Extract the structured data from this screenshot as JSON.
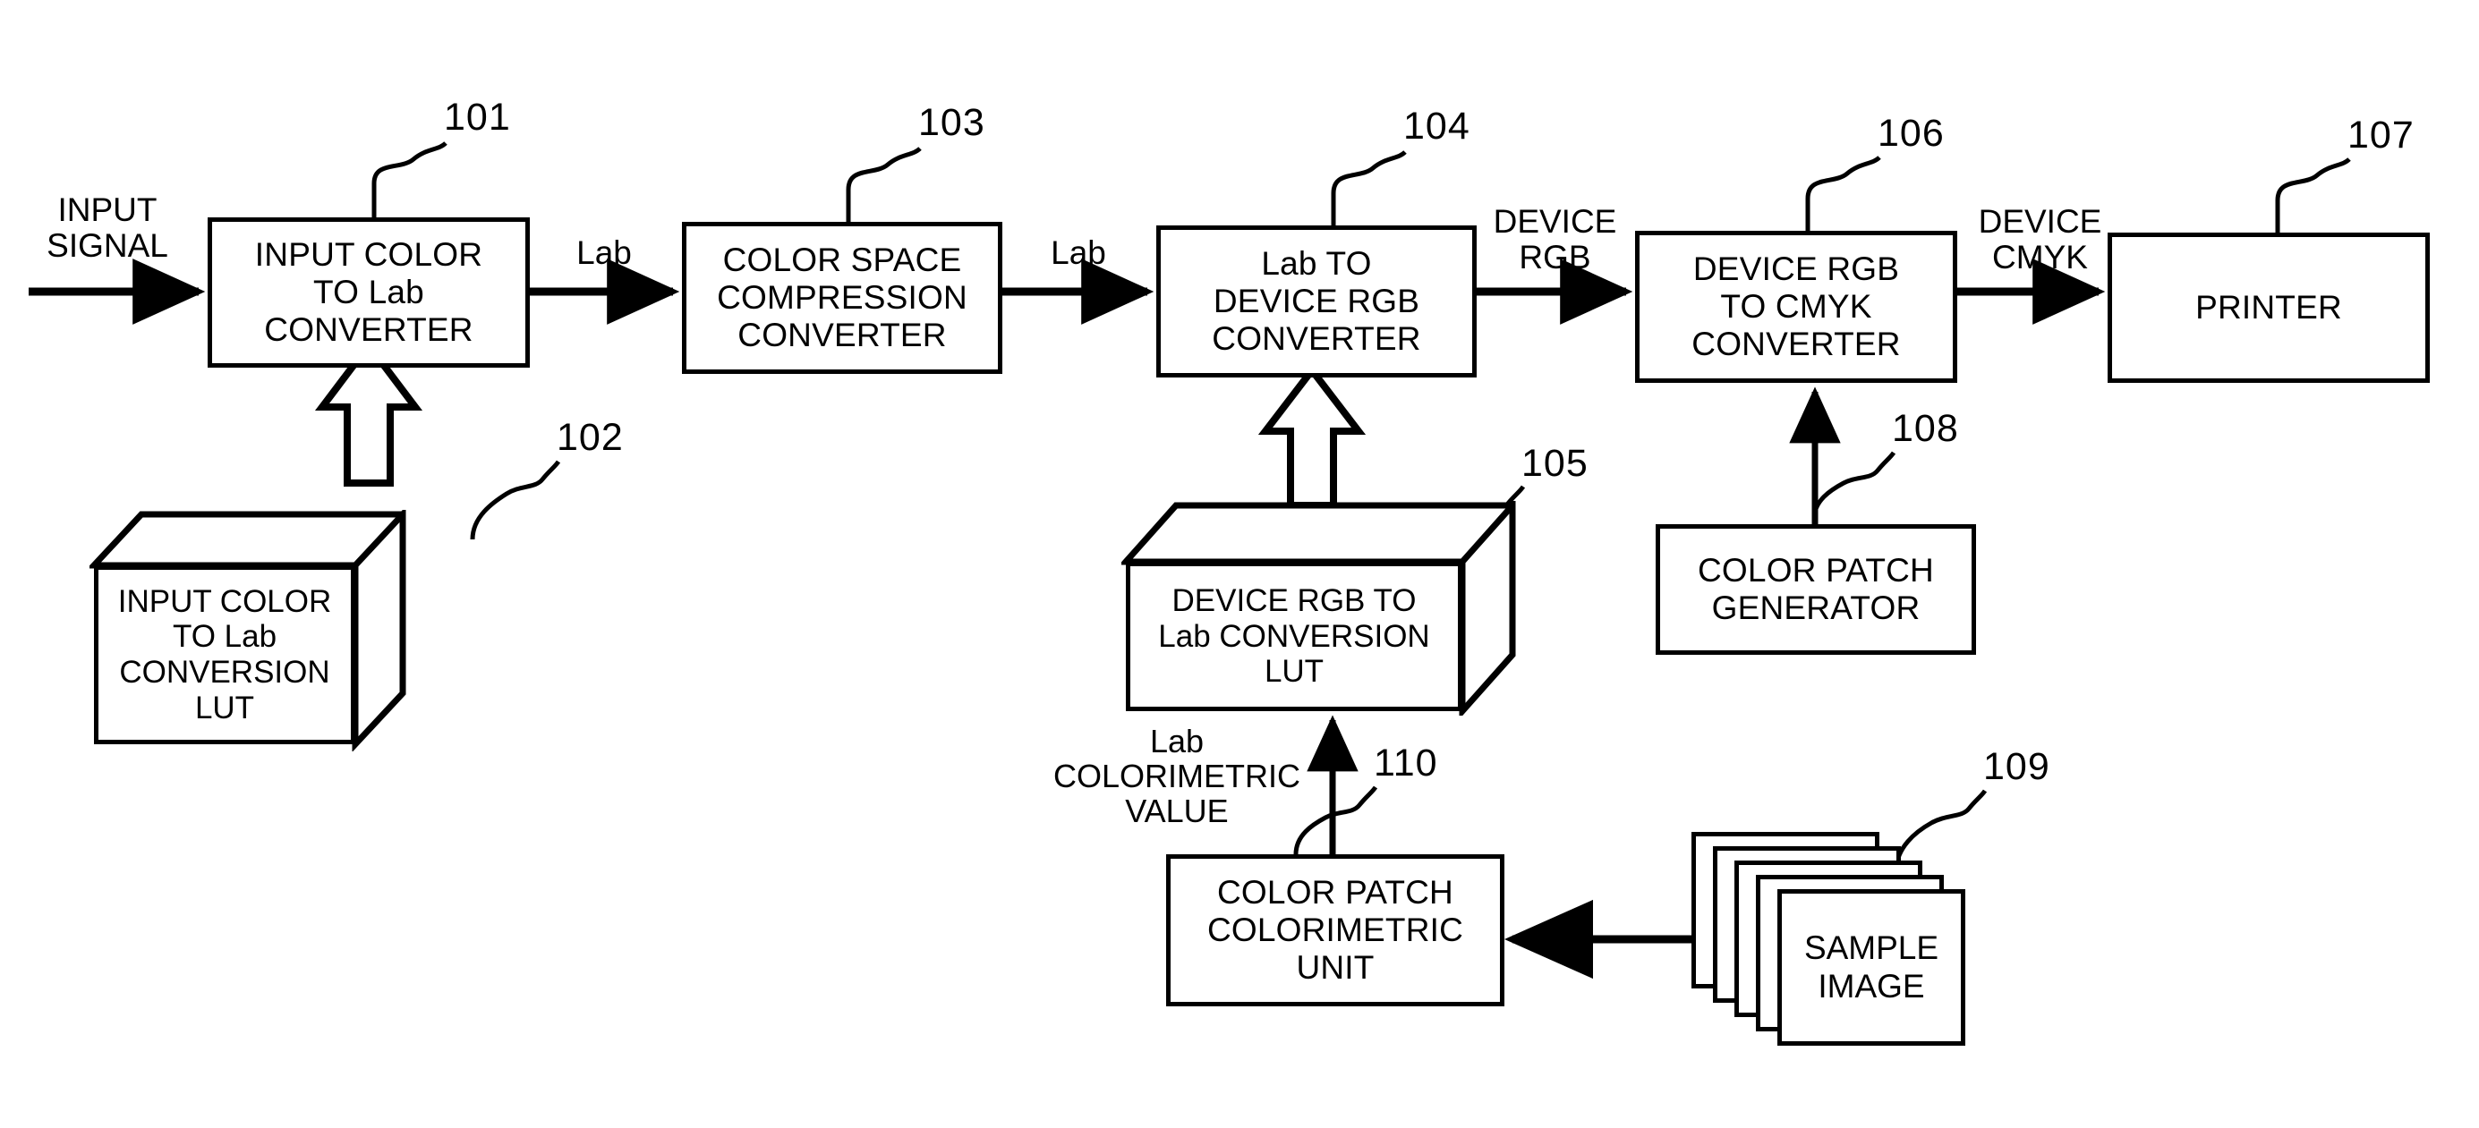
{
  "figure": {
    "kind": "patent-block-diagram",
    "background_color": "#ffffff",
    "line_color": "#000000"
  },
  "blocks": {
    "input_color_to_lab_converter": {
      "ref": "101",
      "label": "INPUT COLOR\nTO Lab\nCONVERTER"
    },
    "input_color_to_lab_lut": {
      "ref": "102",
      "label": "INPUT COLOR\nTO Lab\nCONVERSION LUT"
    },
    "color_space_compression": {
      "ref": "103",
      "label": "COLOR SPACE\nCOMPRESSION\nCONVERTER"
    },
    "lab_to_device_rgb_converter": {
      "ref": "104",
      "label": "Lab TO\nDEVICE RGB\nCONVERTER"
    },
    "device_rgb_to_lab_lut": {
      "ref": "105",
      "label": "DEVICE RGB TO\nLab CONVERSION\nLUT"
    },
    "device_rgb_to_cmyk_converter": {
      "ref": "106",
      "label": "DEVICE RGB\nTO CMYK\nCONVERTER"
    },
    "printer": {
      "ref": "107",
      "label": "PRINTER"
    },
    "color_patch_generator": {
      "ref": "108",
      "label": "COLOR PATCH\nGENERATOR"
    },
    "sample_image": {
      "ref": "109",
      "label": "SAMPLE\nIMAGE"
    },
    "color_patch_colorimetric_unit": {
      "ref": "110",
      "label": "COLOR PATCH\nCOLORIMETRIC\nUNIT"
    }
  },
  "signal_labels": {
    "input_signal": "INPUT\nSIGNAL",
    "lab_1": "Lab",
    "lab_2": "Lab",
    "device_rgb": "DEVICE\nRGB",
    "device_cmyk": "DEVICE\nCMYK",
    "lab_colorimetric_value": "Lab\nCOLORIMETRIC\nVALUE"
  },
  "reference_numerals": [
    "101",
    "102",
    "103",
    "104",
    "105",
    "106",
    "107",
    "108",
    "109",
    "110"
  ]
}
